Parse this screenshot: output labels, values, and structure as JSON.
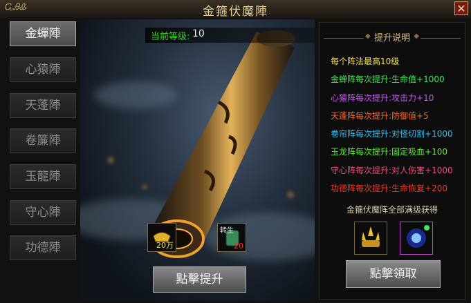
{
  "window": {
    "title": "金箍伏魔陣",
    "close_symbol": "✕"
  },
  "logo_text": "ᏩᎯᎲ",
  "tabs": [
    {
      "label": "金蟬陣",
      "active": true
    },
    {
      "label": "心猿陣",
      "active": false
    },
    {
      "label": "天蓬陣",
      "active": false
    },
    {
      "label": "卷簾陣",
      "active": false
    },
    {
      "label": "玉龍陣",
      "active": false
    },
    {
      "label": "守心陣",
      "active": false
    },
    {
      "label": "功德陣",
      "active": false
    }
  ],
  "level": {
    "label": "当前等级:",
    "value": "10"
  },
  "costs": [
    {
      "icon": "gold-ingot-icon",
      "count": "20万",
      "count_color": "#f2e35a"
    },
    {
      "icon": "jade-token-icon",
      "badge": "转生",
      "count": "20",
      "count_color": "#ff2a2a"
    }
  ],
  "upgrade_button": "點擊提升",
  "panel": {
    "title": "提升说明",
    "lines": [
      {
        "text": "每个阵法最高10级",
        "color": "#f6e04a"
      },
      {
        "text": "金蝉阵每次提升:生命值+1000",
        "color": "#3ee85a"
      },
      {
        "text": "心猿阵每次提升:攻击力+10",
        "color": "#c45af0"
      },
      {
        "text": "天蓬阵每次提升:防御值+5",
        "color": "#f06a32"
      },
      {
        "text": "卷帘阵每次提升:对怪切割+1000",
        "color": "#33bff0"
      },
      {
        "text": "玉龙阵每次提升:固定吸血+100",
        "color": "#59f02a"
      },
      {
        "text": "守心阵每次提升:对人伤害+1000",
        "color": "#f04c7e"
      },
      {
        "text": "功德阵每次提升:生命恢复+200",
        "color": "#f03a2a"
      }
    ],
    "reward_caption": "金箍伏魔阵全部满级获得",
    "rewards": [
      "golden-trident-icon",
      "blue-orb-icon"
    ],
    "claim_button": "點擊領取"
  }
}
